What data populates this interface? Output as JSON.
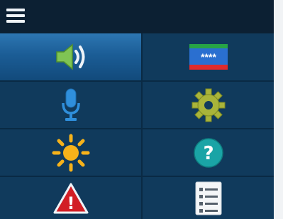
{
  "screen": {
    "menu_icon": "hamburger-menu-icon",
    "tiles": [
      {
        "id": "sound",
        "icon": "speaker-volume-icon",
        "selected": true
      },
      {
        "id": "pin",
        "icon": "pin-code-card-icon",
        "label": "****",
        "selected": false
      },
      {
        "id": "voice",
        "icon": "microphone-icon",
        "selected": false
      },
      {
        "id": "settings",
        "icon": "gear-icon",
        "selected": false
      },
      {
        "id": "brightness",
        "icon": "sun-icon",
        "selected": false
      },
      {
        "id": "help",
        "icon": "question-mark-icon",
        "label": "?",
        "selected": false
      },
      {
        "id": "warning",
        "icon": "warning-triangle-icon",
        "label": "!",
        "selected": false
      },
      {
        "id": "list",
        "icon": "list-document-icon",
        "selected": false
      }
    ]
  },
  "colors": {
    "background": "#103a5c",
    "topbar": "#0c2033",
    "selected_tile": "#1b5d96",
    "speaker_green": "#7fc454",
    "mic_blue": "#2f8fdc",
    "gear_olive": "#a9b43a",
    "sun_yellow": "#f6b21a",
    "help_teal": "#1aa4a6",
    "warning_red": "#d21e25"
  }
}
